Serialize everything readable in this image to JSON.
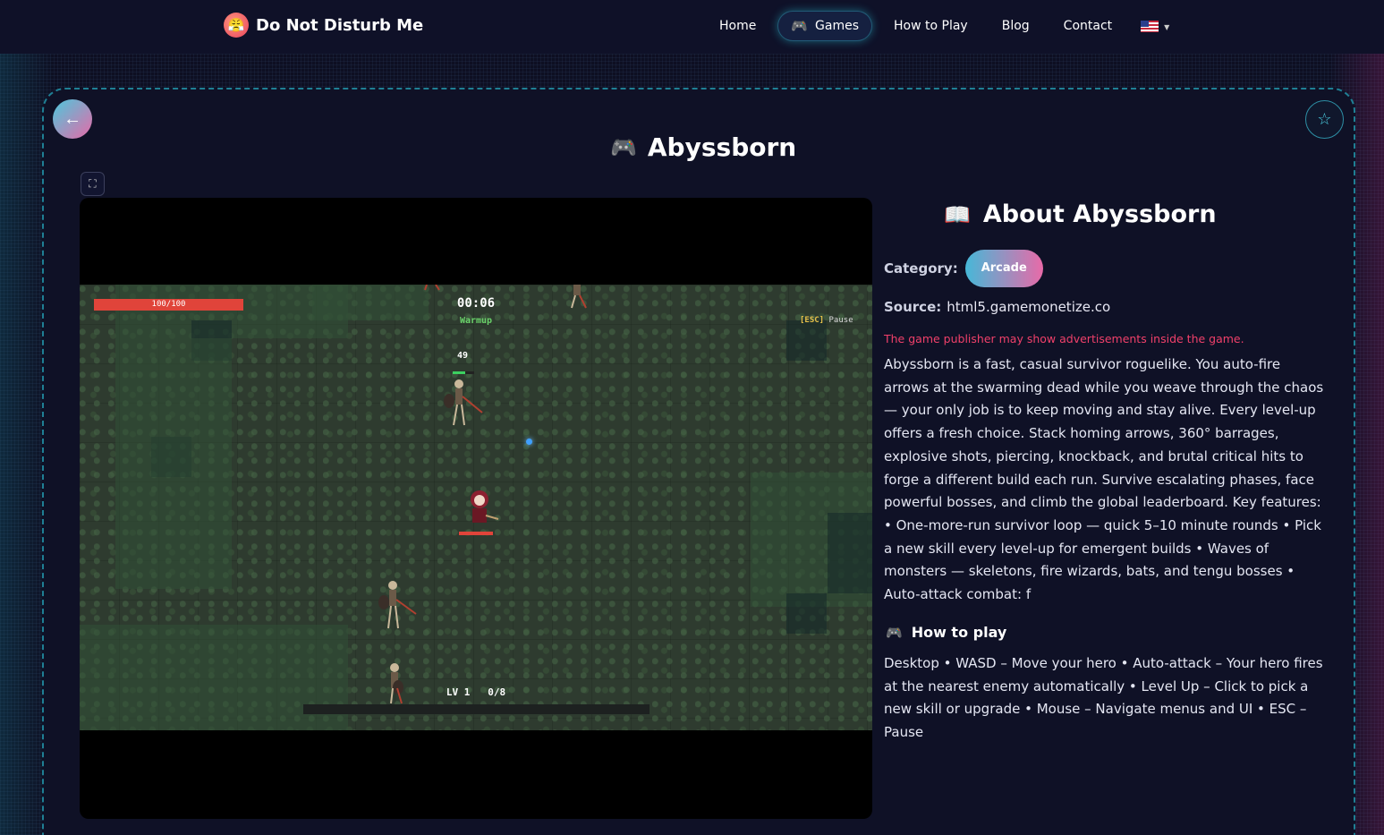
{
  "header": {
    "site_name": "Do Not Disturb Me",
    "nav": [
      {
        "label": "Home",
        "active": false
      },
      {
        "label": "Games",
        "active": true
      },
      {
        "label": "How to Play",
        "active": false
      },
      {
        "label": "Blog",
        "active": false
      },
      {
        "label": "Contact",
        "active": false
      }
    ],
    "language_icon": "us-flag-icon"
  },
  "page": {
    "title": "Abyssborn",
    "back_icon": "←",
    "favorite_icon": "☆",
    "fullscreen_icon": "⛶"
  },
  "game_hud": {
    "hp_text": "100/100",
    "timer": "00:06",
    "phase": "Warmup",
    "esc_key": "[ESC]",
    "esc_label": "Pause",
    "damage_number": "49",
    "level_text": "LV 1   0/8"
  },
  "about": {
    "title": "About Abyssborn",
    "category_label": "Category:",
    "category_value": "Arcade",
    "source_label": "Source:",
    "source_value": "html5.gamemonetize.co",
    "ads_warning": "The game publisher may show advertisements inside the game.",
    "description": "Abyssborn is a fast, casual survivor roguelike. You auto-fire arrows at the swarming dead while you weave through the chaos — your only job is to keep moving and stay alive. Every level-up offers a fresh choice. Stack homing arrows, 360° barrages, explosive shots, piercing, knockback, and brutal critical hits to forge a different build each run. Survive escalating phases, face powerful bosses, and climb the global leaderboard. Key features: • One-more-run survivor loop — quick 5–10 minute rounds • Pick a new skill every level-up for emergent builds • Waves of monsters — skeletons, fire wizards, bats, and tengu bosses • Auto-attack combat: f"
  },
  "how_to_play": {
    "title": "How to play",
    "text": "Desktop • WASD – Move your hero • Auto-attack – Your hero fires at the nearest enemy automatically • Level Up – Click to pick a new skill or upgrade • Mouse – Navigate menus and UI • ESC – Pause"
  }
}
